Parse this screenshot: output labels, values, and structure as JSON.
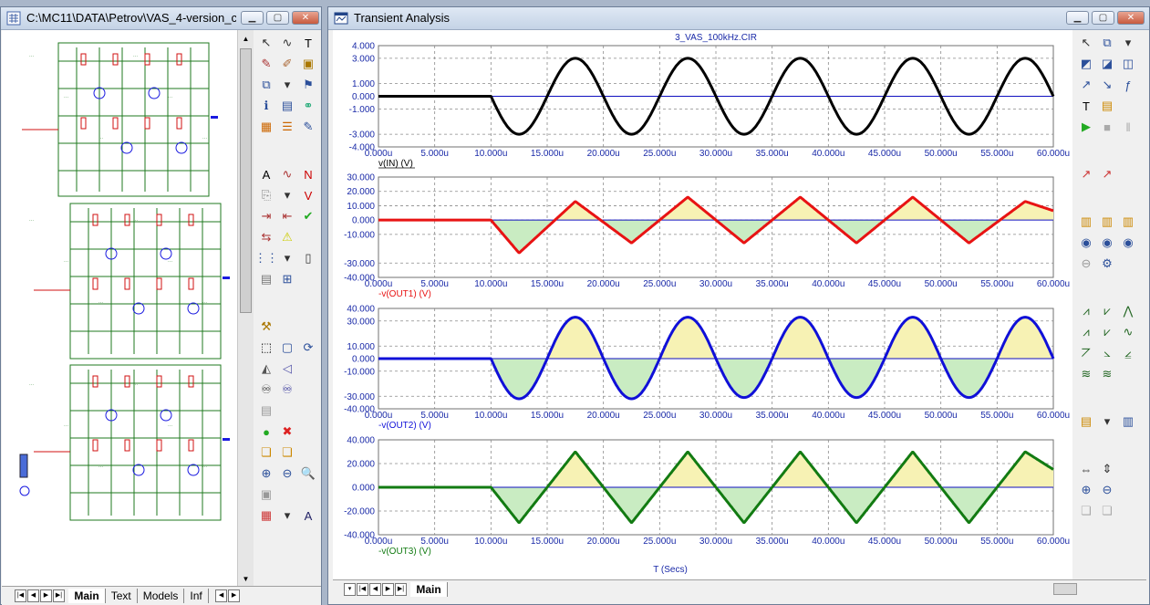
{
  "left_window": {
    "title": "C:\\MC11\\DATA\\Petrov\\VAS_4-version_c...",
    "tabs": [
      "Main",
      "Text",
      "Models",
      "Inf"
    ],
    "active_tab": "Main"
  },
  "right_window": {
    "title": "Transient Analysis",
    "tabs": [
      "Main"
    ],
    "active_tab": "Main"
  },
  "colors": {
    "trace1": "#000000",
    "trace2": "#e81313",
    "trace3": "#1010d8",
    "trace4": "#127b12",
    "fill_pos": "#f7f2b4",
    "fill_neg": "#c9ecc2",
    "axis_text": "#1a2aa8",
    "zero_line": "#1010c0"
  },
  "chart_data": [
    {
      "type": "line",
      "title": "3_VAS_100kHz.CIR",
      "series": [
        {
          "name": "v(IN) (V)",
          "color": "#000000",
          "amplitude": 3.0,
          "shape": "sine",
          "start": 10.0,
          "period": 10.0,
          "invert": true
        }
      ],
      "ylim": [
        -4.0,
        4.0
      ],
      "y_ticks": [
        "4.000",
        "3.000",
        "1.000",
        "0.000",
        "-1.000",
        "-3.000",
        "-4.000"
      ],
      "y_tick_values": [
        4,
        3,
        1,
        0,
        -1,
        -3,
        -4
      ],
      "xlim": [
        0,
        60
      ],
      "x_ticks": [
        "0.000u",
        "5.000u",
        "10.000u",
        "15.000u",
        "20.000u",
        "25.000u",
        "30.000u",
        "35.000u",
        "40.000u",
        "45.000u",
        "50.000u",
        "55.000u",
        "60.000u"
      ],
      "label": "v(IN) (V)",
      "shaded": false
    },
    {
      "type": "line",
      "series": [
        {
          "name": "-v(OUT1) (V)",
          "color": "#e81313",
          "amplitude": 0,
          "shape": "triangle",
          "start": 10.0,
          "period": 10.0,
          "peaks": [
            -23,
            13,
            -16,
            16,
            -16,
            16,
            -16,
            16,
            -16,
            13
          ]
        }
      ],
      "ylim": [
        -40.0,
        30.0
      ],
      "y_ticks": [
        "30.000",
        "20.000",
        "10.000",
        "0.000",
        "-10.000",
        "-30.000",
        "-40.000"
      ],
      "y_tick_values": [
        30,
        20,
        10,
        0,
        -10,
        -30,
        -40
      ],
      "xlim": [
        0,
        60
      ],
      "x_ticks": [
        "0.000u",
        "5.000u",
        "10.000u",
        "15.000u",
        "20.000u",
        "25.000u",
        "30.000u",
        "35.000u",
        "40.000u",
        "45.000u",
        "50.000u",
        "55.000u",
        "60.000u"
      ],
      "label": "-v(OUT1) (V)",
      "shaded": true
    },
    {
      "type": "line",
      "series": [
        {
          "name": "-v(OUT2) (V)",
          "color": "#1010d8",
          "amplitude": 0,
          "shape": "rounded",
          "start": 10.0,
          "period": 10.0,
          "peaks": [
            -32,
            33,
            -32,
            33,
            -31,
            33,
            -31,
            33,
            -31,
            33
          ]
        }
      ],
      "ylim": [
        -40.0,
        40.0
      ],
      "y_ticks": [
        "40.000",
        "30.000",
        "10.000",
        "0.000",
        "-10.000",
        "-30.000",
        "-40.000"
      ],
      "y_tick_values": [
        40,
        30,
        10,
        0,
        -10,
        -30,
        -40
      ],
      "xlim": [
        0,
        60
      ],
      "x_ticks": [
        "0.000u",
        "5.000u",
        "10.000u",
        "15.000u",
        "20.000u",
        "25.000u",
        "30.000u",
        "35.000u",
        "40.000u",
        "45.000u",
        "50.000u",
        "55.000u",
        "60.000u"
      ],
      "label": "-v(OUT2) (V)",
      "shaded": true
    },
    {
      "type": "line",
      "series": [
        {
          "name": "-v(OUT3) (V)",
          "color": "#127b12",
          "amplitude": 0,
          "shape": "triangle",
          "start": 10.0,
          "period": 10.0,
          "peaks": [
            -30,
            30,
            -30,
            30,
            -30,
            30,
            -30,
            30,
            -30,
            30
          ]
        }
      ],
      "ylim": [
        -40.0,
        40.0
      ],
      "y_ticks": [
        "40.000",
        "20.000",
        "0.000",
        "-20.000",
        "-40.000"
      ],
      "y_tick_values": [
        40,
        20,
        0,
        -20,
        -40
      ],
      "xlim": [
        0,
        60
      ],
      "x_ticks": [
        "0.000u",
        "5.000u",
        "10.000u",
        "15.000u",
        "20.000u",
        "25.000u",
        "30.000u",
        "35.000u",
        "40.000u",
        "45.000u",
        "50.000u",
        "55.000u",
        "60.000u"
      ],
      "label": "-v(OUT3) (V)",
      "xlabel": "T (Secs)",
      "shaded": true
    }
  ]
}
